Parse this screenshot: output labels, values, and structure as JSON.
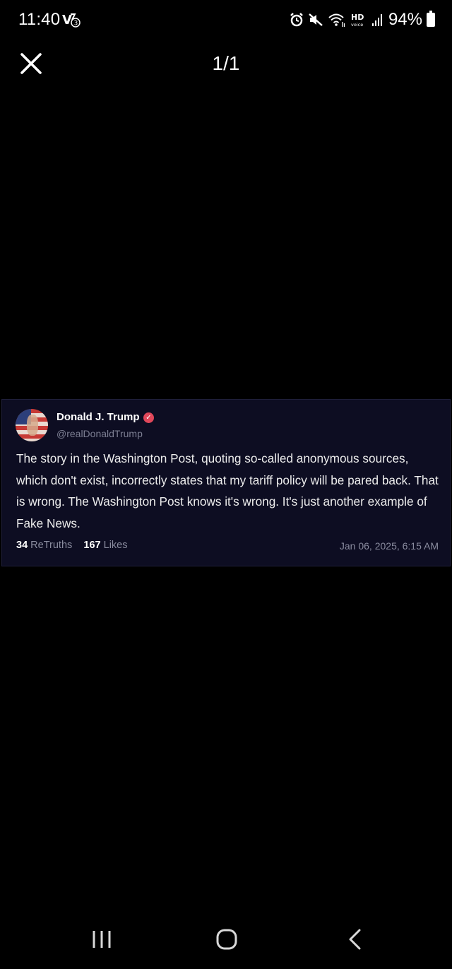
{
  "status_bar": {
    "time": "11:40",
    "battery": "94%",
    "icons": [
      "carrier-icon",
      "alarm-icon",
      "mute-icon",
      "wifi-icon",
      "hd-voice-icon",
      "signal-icon",
      "battery-icon"
    ]
  },
  "viewer": {
    "close_icon": "close-icon",
    "page_counter": "1/1"
  },
  "post": {
    "author_name": "Donald J. Trump",
    "verified_badge": "✓",
    "handle": "@realDonaldTrump",
    "body": "The story in the Washington Post, quoting so-called anonymous sources, which don't exist, incorrectly states that my tariff policy will be pared back. That is wrong. The Washington Post knows it's wrong. It's just another example of Fake News.",
    "retruths_count": "34",
    "retruths_label": "ReTruths",
    "likes_count": "167",
    "likes_label": "Likes",
    "date": "Jan 06, 2025, 6:15 AM"
  },
  "nav_bar": {
    "buttons": [
      "recents-icon",
      "home-icon",
      "back-icon"
    ]
  },
  "colors": {
    "background": "#000000",
    "card_background": "#0d0d22",
    "verified": "#e0475a",
    "muted_text": "#8a8c9f"
  }
}
